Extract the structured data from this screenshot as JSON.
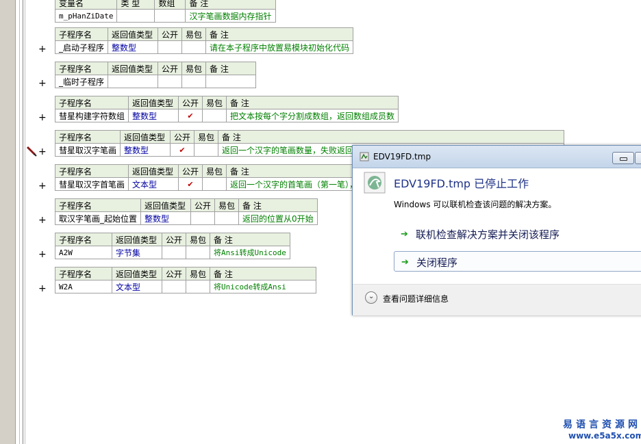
{
  "var_table": {
    "headers": [
      "变量名",
      "类 型",
      "数组",
      "备 注"
    ],
    "row": [
      "m_pHanZiDate",
      "",
      "",
      "汉字笔画数据内存指针"
    ]
  },
  "headers": {
    "name": "子程序名",
    "ret": "返回值类型",
    "public": "公开",
    "easy": "易包",
    "note": "备 注"
  },
  "procs": [
    {
      "name": "_启动子程序",
      "ret": "整数型",
      "public": "",
      "note": "请在本子程序中放置易模块初始化代码"
    },
    {
      "name": "_临时子程序",
      "ret": "",
      "public": "",
      "note": ""
    },
    {
      "name": "彗星构建字符数组",
      "ret": "整数型",
      "public": "✔",
      "note": "把文本按每个字分割成数组，返回数组成员数"
    },
    {
      "name": "彗星取汉字笔画",
      "ret": "整数型",
      "public": "✔",
      "note": "返回一个汉字的笔画数量，失败返回0"
    },
    {
      "name": "彗星取汉字首笔画",
      "ret": "文本型",
      "public": "✔",
      "note": "返回一个汉字的首笔画（第一笔），失败返回空"
    },
    {
      "name": "取汉字笔画_起始位置",
      "ret": "整数型",
      "public": "",
      "note": "返回的位置从0开始"
    },
    {
      "name": "A2W",
      "ret": "字节集",
      "public": "",
      "note": "将Ansi转成Unicode"
    },
    {
      "name": "W2A",
      "ret": "文本型",
      "public": "",
      "note": "将Unicode转成Ansi"
    }
  ],
  "gutter": {
    "plus": "+"
  },
  "dialog": {
    "title": "EDV19FD.tmp",
    "heading": "EDV19FD.tmp 已停止工作",
    "subtitle": "Windows 可以联机检查该问题的解决方案。",
    "option1": "联机检查解决方案并关闭该程序",
    "option2": "关闭程序",
    "details": "查看问题详细信息",
    "arrow": "➔"
  },
  "watermark": {
    "line1": "易语言资源网",
    "line2": "www.e5a5x.com"
  },
  "colors": {
    "header_bg": "#e8f0e0",
    "type_blue": "#0000a0",
    "note_green": "#008000",
    "check_red": "#c00000"
  }
}
